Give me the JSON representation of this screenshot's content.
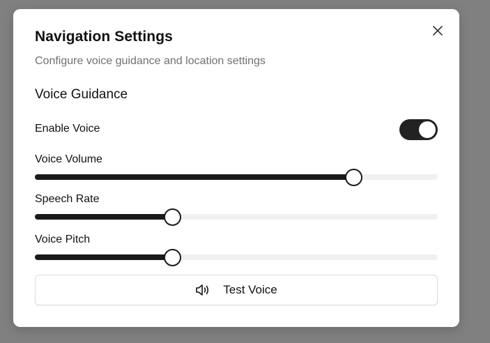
{
  "dialog": {
    "title": "Navigation Settings",
    "subtitle": "Configure voice guidance and location settings",
    "close_icon": "close-icon"
  },
  "voice_guidance": {
    "section_title": "Voice Guidance",
    "enable_voice": {
      "label": "Enable Voice",
      "enabled": true
    },
    "sliders": [
      {
        "label": "Voice Volume",
        "value_fraction": 0.79
      },
      {
        "label": "Speech Rate",
        "value_fraction": 0.34
      },
      {
        "label": "Voice Pitch",
        "value_fraction": 0.34
      }
    ],
    "test_button": {
      "label": "Test Voice",
      "icon": "speaker-icon"
    }
  },
  "colors": {
    "backdrop": "#808080",
    "accent": "#1a1a1a",
    "track": "#f0f0f0",
    "muted_text": "#707070"
  }
}
